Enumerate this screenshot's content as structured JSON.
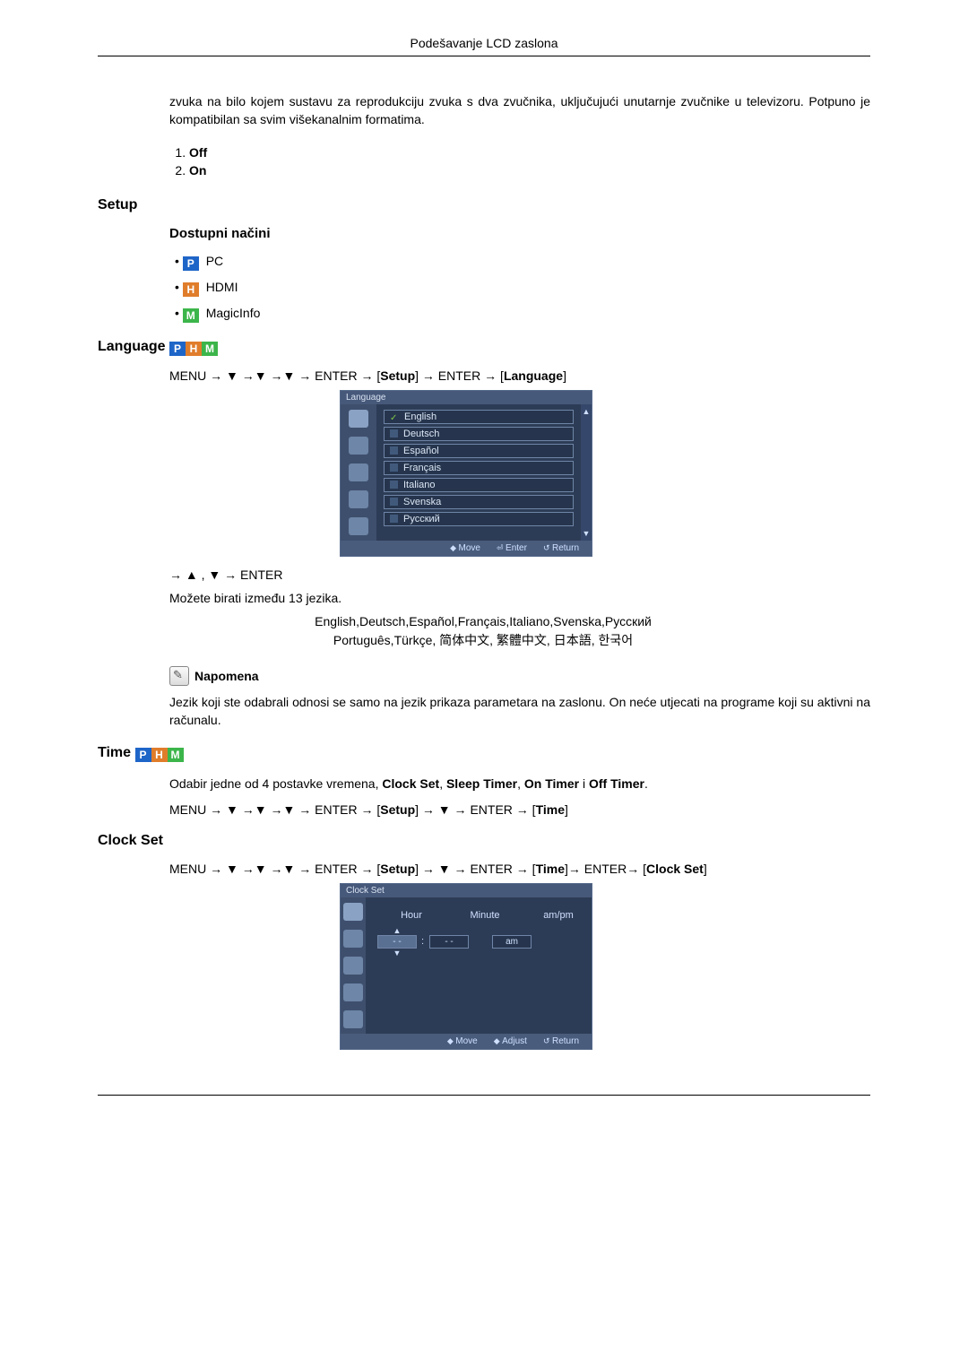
{
  "header": {
    "title": "Podešavanje LCD zaslona"
  },
  "intro": {
    "paragraph": "zvuka na bilo kojem sustavu za reprodukciju zvuka s dva zvučnika, uključujući unutarnje zvučnike u televizoru. Potpuno je kompatibilan sa svim višekanalnim formatima.",
    "options": [
      "Off",
      "On"
    ]
  },
  "setup": {
    "heading": "Setup",
    "modes_heading": "Dostupni načini",
    "modes": [
      {
        "badge": "P",
        "label": "PC"
      },
      {
        "badge": "H",
        "label": "HDMI"
      },
      {
        "badge": "M",
        "label": "MagicInfo"
      }
    ]
  },
  "language": {
    "heading": "Language",
    "path_prefix": "MENU → ▼ →▼ →▼ → ENTER → [",
    "path_mid1": "Setup",
    "path_mid2": "] → ENTER → [",
    "path_end": "Language",
    "path_close": "]",
    "osd": {
      "title": "Language",
      "items": [
        "English",
        "Deutsch",
        "Español",
        "Français",
        "Italiano",
        "Svenska",
        "Русский"
      ],
      "selected_index": 0,
      "footer": {
        "move": "Move",
        "enter": "Enter",
        "return": "Return"
      }
    },
    "after_osd": "→ ▲ , ▼ → ENTER",
    "body1": "Možete birati između 13 jezika.",
    "langs_line1": "English,Deutsch,Español,Français,Italiano,Svenska,Русский",
    "langs_line2": "Português,Türkçe, 简体中文,  繁體中文, 日本語, 한국어",
    "note_label": "Napomena",
    "note_text": "Jezik koji ste odabrali odnosi se samo na jezik prikaza parametara na zaslonu. On neće utjecati na programe koji su aktivni na računalu."
  },
  "time": {
    "heading": "Time",
    "desc_pre": "Odabir jedne od 4 postavke vremena, ",
    "opts": [
      "Clock Set",
      "Sleep Timer",
      "On Timer",
      "Off Timer"
    ],
    "desc_join": ", ",
    "desc_and": " i ",
    "desc_end": ".",
    "path_prefix": "MENU → ▼ →▼ →▼ → ENTER → [",
    "path_mid1": "Setup",
    "path_mid2": "] → ▼ → ENTER → [",
    "path_end": "Time",
    "path_close": "]"
  },
  "clockset": {
    "heading": "Clock Set",
    "path_prefix": "MENU → ▼ →▼ →▼ → ENTER → [",
    "path_mid1": "Setup",
    "path_mid2": "] → ▼ → ENTER → [",
    "path_mid3": "Time",
    "path_mid4": "]→ ENTER→ [",
    "path_end": "Clock Set",
    "path_close": "]",
    "osd": {
      "title": "Clock Set",
      "cols": [
        "Hour",
        "Minute",
        "am/pm"
      ],
      "vals": [
        "- -",
        "- -",
        "am"
      ],
      "footer": {
        "move": "Move",
        "adjust": "Adjust",
        "return": "Return"
      }
    }
  }
}
